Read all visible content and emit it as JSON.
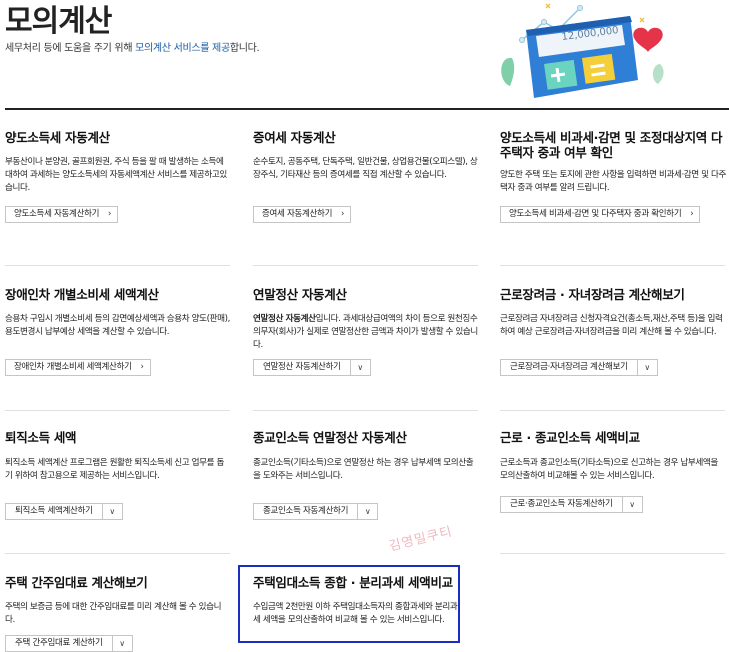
{
  "header": {
    "title": "모의계산",
    "subtitle_pre": "세무처리 등에 도움을 주기 위해 ",
    "subtitle_hl": "모의계산 서비스를 제공",
    "subtitle_post": "합니다.",
    "calc_display": "12,000,000"
  },
  "watermark": "김영밀쿠티",
  "cards": [
    {
      "title": "양도소득세 자동계산",
      "desc": "부동산이나 분양권, 골프회원권, 주식 등을 팔 때 발생하는 소득에 대하여 과세하는 양도소득세의 자동세액계산 서비스를 제공하고있습니다.",
      "button": "양도소득세 자동계산하기"
    },
    {
      "title": "증여세 자동계산",
      "desc": "순수토지, 공동주택, 단독주택, 일반건물, 상업용건물(오피스텔), 상장주식, 기타재산 등의 증여세를 직접 계산할 수 있습니다.",
      "button": "증여세 자동계산하기"
    },
    {
      "title": "양도소득세 비과세·감면 및 조정대상지역 다주택자 중과 여부 확인",
      "desc": "양도한 주택 또는 토지에 관한 사항을 입력하면 비과세·감면 및 다주택자 중과 여부를 알려 드립니다.",
      "button": "양도소득세 비과세·감면 및 다주택자 중과 확인하기"
    },
    {
      "title": "장애인차 개별소비세 세액계산",
      "desc": "승용차 구입시 개별소비세 등의 감면예상세액과 승용차 양도(판매), 용도변경시 납부예상 세액을 계산할 수 있습니다.",
      "button": "장애인차 개별소비세 세액계산하기"
    },
    {
      "title": "연말정산 자동계산",
      "desc_bold": "연말정산 자동계산",
      "desc": "입니다. 과세대상급여액의 차이 등으로 원천징수의무자(회사)가 실제로 연말정산한 금액과 차이가 발생할 수 있습니다.",
      "select": "연말정산 자동계산하기"
    },
    {
      "title": "근로장려금 · 자녀장려금 계산해보기",
      "desc": "근로장려금 자녀장려금 신청자격요건(총소득,재산,주택 등)을 입력하여 예상 근로장려금·자녀장려금을 미리 계산해 볼 수 있습니다.",
      "select": "근로장려금·자녀장려금 계산해보기"
    },
    {
      "title": "퇴직소득 세액",
      "desc": "퇴직소득 세액계산 프로그램은 원활한 퇴직소득세 신고 업무를 돕기 위하여 참고용으로 제공하는 서비스입니다.",
      "select": "퇴직소득 세액계산하기"
    },
    {
      "title": "종교인소득 연말정산 자동계산",
      "desc": "종교인소득(기타소득)으로 연말정산 하는 경우 납부세액 모의산출을 도와주는 서비스입니다.",
      "select": "종교인소득 자동계산하기"
    },
    {
      "title": "근로 · 종교인소득 세액비교",
      "desc": "근로소득과 종교인소득(기타소득)으로 신고하는 경우 납부세액을 모의산출하여 비교해볼 수 있는 서비스입니다.",
      "select": "근로·종교인소득 자동계산하기"
    },
    {
      "title": "주택 간주임대료 계산해보기",
      "desc": "주택의 보증금 등에 대한 간주임대료를 미리 계산해 볼 수 있습니다.",
      "select": "주택 간주임대료 계산하기"
    },
    {
      "title": "주택임대소득 종합 · 분리과세 세액비교",
      "desc": "수입금액 2천만원 이하 주택임대소득자의 종합과세와 분리과세 세액을 모의산출하여 비교해 볼 수 있는 서비스입니다."
    }
  ]
}
